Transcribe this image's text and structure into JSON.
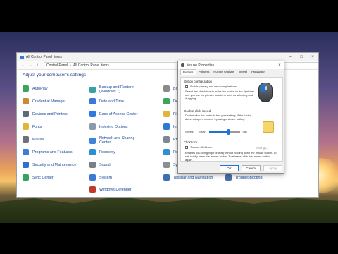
{
  "control_panel": {
    "title": "All Control Panel Items",
    "breadcrumb": [
      "Control Panel",
      "All Control Panel Items"
    ],
    "header": "Adjust your computer's settings",
    "items": [
      {
        "label": "AutoPlay",
        "icon": "autoplay-icon",
        "color": "#3aa65a"
      },
      {
        "label": "Credential Manager",
        "icon": "credential-manager-icon",
        "color": "#c98d2f"
      },
      {
        "label": "Devices and Printers",
        "icon": "printer-icon",
        "color": "#5a6a7a"
      },
      {
        "label": "Fonts",
        "icon": "fonts-icon",
        "color": "#e0b53a"
      },
      {
        "label": "Mouse",
        "icon": "mouse-icon",
        "color": "#6b7278"
      },
      {
        "label": "Programs and Features",
        "icon": "programs-icon",
        "color": "#3e7fd6"
      },
      {
        "label": "Security and Maintenance",
        "icon": "security-flag-icon",
        "color": "#2f6fcf"
      },
      {
        "label": "Sync Center",
        "icon": "sync-icon",
        "color": "#37a35a"
      },
      {
        "label": "Backup and Restore (Windows 7)",
        "icon": "backup-icon",
        "color": "#3aa0a0"
      },
      {
        "label": "Date and Time",
        "icon": "clock-icon",
        "color": "#3b78d8"
      },
      {
        "label": "Ease of Access Center",
        "icon": "ease-of-access-icon",
        "color": "#2d7be0"
      },
      {
        "label": "Indexing Options",
        "icon": "indexing-icon",
        "color": "#8a9aaa"
      },
      {
        "label": "Network and Sharing Center",
        "icon": "network-icon",
        "color": "#3f83d6"
      },
      {
        "label": "Recovery",
        "icon": "recovery-icon",
        "color": "#2b8fd3"
      },
      {
        "label": "Sound",
        "icon": "speaker-icon",
        "color": "#7a7f85"
      },
      {
        "label": "System",
        "icon": "system-icon",
        "color": "#3b78d8"
      },
      {
        "label": "Windows Defender",
        "icon": "defender-icon",
        "color": "#c0392b"
      },
      {
        "label": "BitLo",
        "icon": "bitlocker-icon",
        "color": "#8a8a8a"
      },
      {
        "label": "Defa",
        "icon": "default-programs-icon",
        "color": "#3aa65a"
      },
      {
        "label": "File S",
        "icon": "file-history-icon",
        "color": "#e0b53a"
      },
      {
        "label": "Intern",
        "icon": "internet-options-icon",
        "color": "#2a7bd6"
      },
      {
        "label": "Phon",
        "icon": "phone-modem-icon",
        "color": "#7d8791"
      },
      {
        "label": "Regio",
        "icon": "region-icon",
        "color": "#2f8fd0"
      },
      {
        "label": "Speech Recognition",
        "icon": "microphone-icon",
        "color": "#8a8f94"
      },
      {
        "label": "Taskbar and Navigation",
        "icon": "taskbar-icon",
        "color": "#3b6fb6"
      },
      {
        "label": "Troubleshooting",
        "icon": "troubleshoot-icon",
        "color": "#4a6fa8"
      }
    ]
  },
  "mouse_dialog": {
    "title": "Mouse Properties",
    "tabs": [
      "Buttons",
      "Pointers",
      "Pointer Options",
      "Wheel",
      "Hardware"
    ],
    "active_tab": "Buttons",
    "button_configuration": {
      "label": "Button configuration",
      "checkbox_label": "Switch primary and secondary buttons",
      "description": "Select this check box to make the button on the right the one you use for primary functions such as selecting and dragging."
    },
    "double_click": {
      "label": "Double-click speed",
      "description": "Double-click the folder to test your setting. If the folder does not open or close, try using a slower setting.",
      "speed_label": "Speed:",
      "slow": "Slow",
      "fast": "Fast",
      "speed_value": 0.62
    },
    "clicklock": {
      "label": "ClickLock",
      "checkbox_label": "Turn on ClickLock",
      "settings_label": "Settings...",
      "description": "Enables you to highlight or drag without holding down the mouse button. To set, briefly press the mouse button. To release, click the mouse button again."
    },
    "buttons": {
      "ok": "OK",
      "cancel": "Cancel",
      "apply": "Apply"
    }
  }
}
